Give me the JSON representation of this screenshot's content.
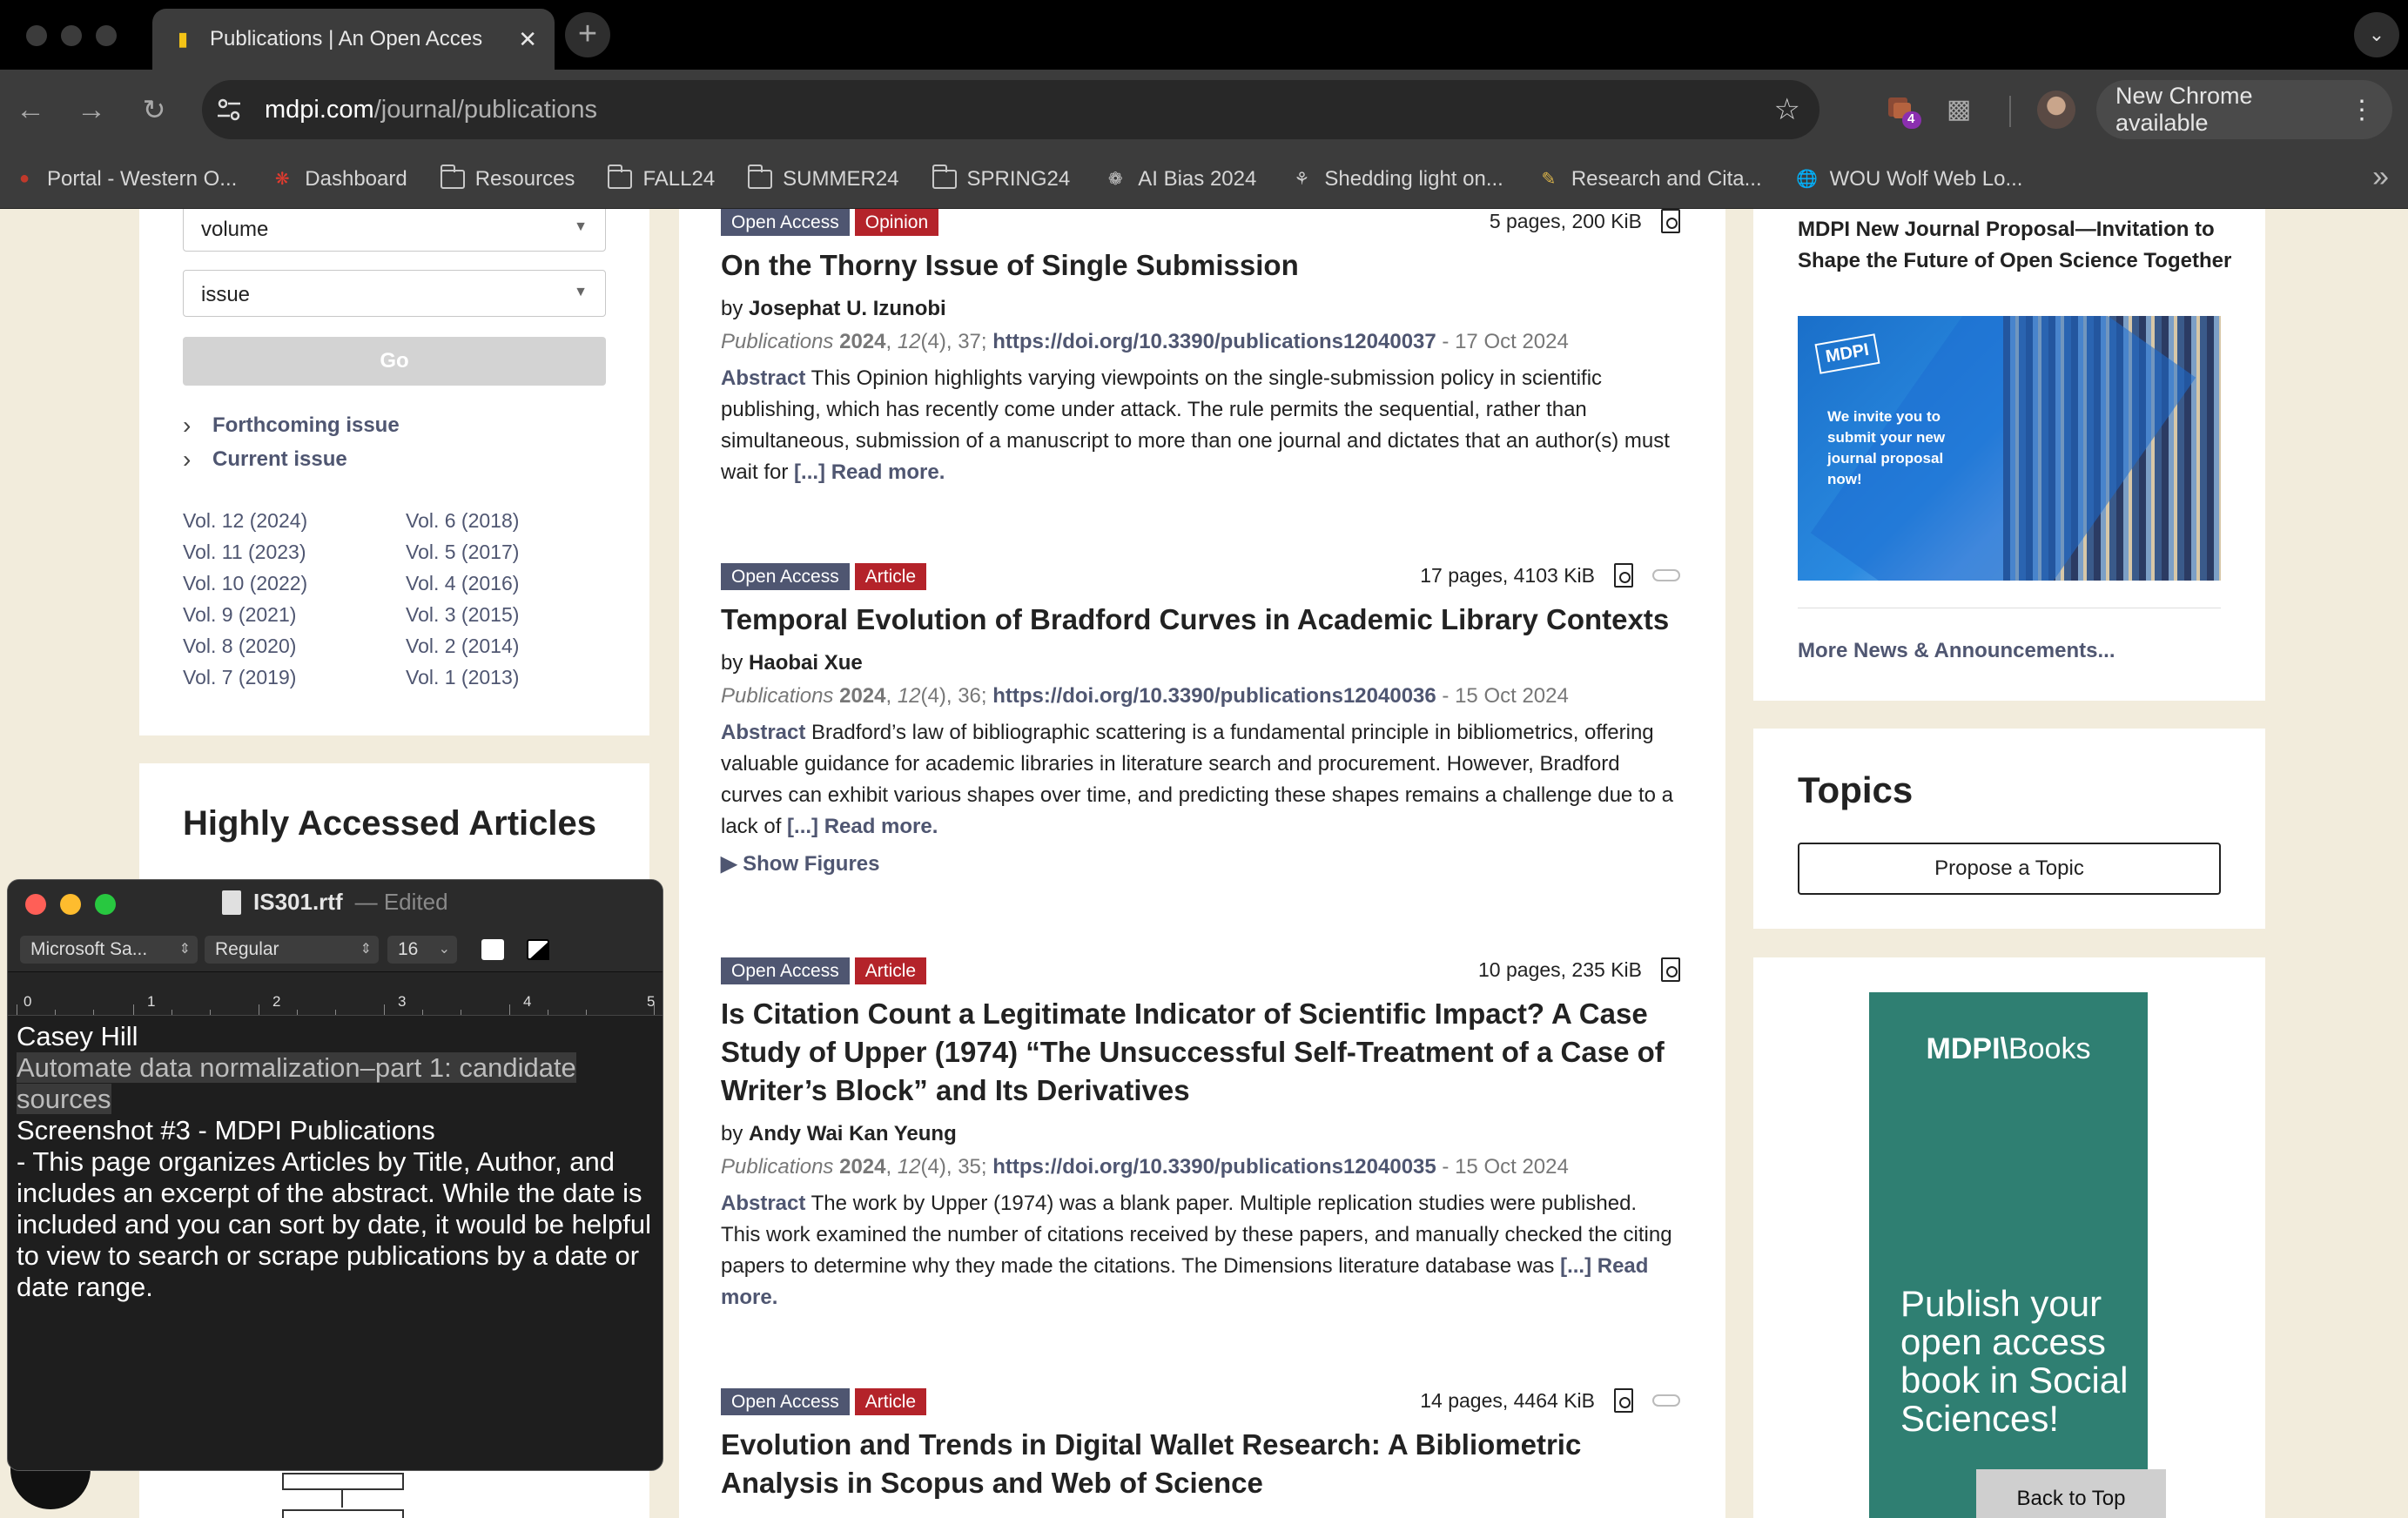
{
  "browser": {
    "tab_title": "Publications | An Open Acces",
    "url_host": "mdpi.com",
    "url_path": "/journal/publications",
    "update_label": "New Chrome available",
    "extension_badge": "4",
    "bookmarks": [
      {
        "label": "Portal - Western O...",
        "icon": "portal-icon"
      },
      {
        "label": "Dashboard",
        "icon": "canvas-icon"
      },
      {
        "label": "Resources",
        "icon": "folder-icon"
      },
      {
        "label": "FALL24",
        "icon": "folder-icon"
      },
      {
        "label": "SUMMER24",
        "icon": "folder-icon"
      },
      {
        "label": "SPRING24",
        "icon": "folder-icon"
      },
      {
        "label": "AI Bias 2024",
        "icon": "ai-icon"
      },
      {
        "label": "Shedding light on...",
        "icon": "network-icon"
      },
      {
        "label": "Research and Cita...",
        "icon": "research-icon"
      },
      {
        "label": "WOU Wolf Web Lo...",
        "icon": "globe-icon"
      }
    ]
  },
  "sidebar": {
    "volume_placeholder": "volume",
    "issue_placeholder": "issue",
    "go_label": "Go",
    "forthcoming_label": "Forthcoming issue",
    "current_label": "Current issue",
    "volumes_left": [
      "Vol. 12 (2024)",
      "Vol. 11 (2023)",
      "Vol. 10 (2022)",
      "Vol. 9 (2021)",
      "Vol. 8 (2020)",
      "Vol. 7 (2019)"
    ],
    "volumes_right": [
      "Vol. 6 (2018)",
      "Vol. 5 (2017)",
      "Vol. 4 (2016)",
      "Vol. 3 (2015)",
      "Vol. 2 (2014)",
      "Vol. 1 (2013)"
    ],
    "highly_accessed_heading": "Highly Accessed Articles"
  },
  "articles": [
    {
      "access": "Open Access",
      "type": "Opinion",
      "meta": "5 pages, 200 KiB",
      "title": "On the Thorny Issue of Single Submission",
      "by_prefix": "by",
      "authors": "Josephat U. Izunobi",
      "journal": "Publications",
      "year": "2024",
      "volume": "12",
      "issue_pages": "(4), 37;",
      "doi": "https://doi.org/10.3390/publications12040037",
      "date": "- 17 Oct 2024",
      "abstract_label": "Abstract",
      "abstract": "This Opinion highlights varying viewpoints on the single-submission policy in scientific publishing, which has recently come under attack. The rule permits the sequential, rather than simultaneous, submission of a manuscript to more than one journal and dictates that an author(s) must wait for",
      "more": "[...] Read more."
    },
    {
      "access": "Open Access",
      "type": "Article",
      "meta": "17 pages, 4103 KiB",
      "title": "Temporal Evolution of Bradford Curves in Academic Library Contexts",
      "by_prefix": "by",
      "authors": "Haobai Xue",
      "journal": "Publications",
      "year": "2024",
      "volume": "12",
      "issue_pages": "(4), 36;",
      "doi": "https://doi.org/10.3390/publications12040036",
      "date": "- 15 Oct 2024",
      "abstract_label": "Abstract",
      "abstract": "Bradford’s law of bibliographic scattering is a fundamental principle in bibliometrics, offering valuable guidance for academic libraries in literature search and procurement. However, Bradford curves can exhibit various shapes over time, and predicting these shapes remains a challenge due to a lack of",
      "more": "[...] Read more.",
      "show_figures": "▶ Show Figures"
    },
    {
      "access": "Open Access",
      "type": "Article",
      "meta": "10 pages, 235 KiB",
      "title": "Is Citation Count a Legitimate Indicator of Scientific Impact? A Case Study of Upper (1974) “The Unsuccessful Self-Treatment of a Case of Writer’s Block” and Its Derivatives",
      "by_prefix": "by",
      "authors": "Andy Wai Kan Yeung",
      "journal": "Publications",
      "year": "2024",
      "volume": "12",
      "issue_pages": "(4), 35;",
      "doi": "https://doi.org/10.3390/publications12040035",
      "date": "- 15 Oct 2024",
      "abstract_label": "Abstract",
      "abstract": "The work by Upper (1974) was a blank paper. Multiple replication studies were published. This work examined the number of citations received by these papers, and manually checked the citing papers to determine why they made the citations. The Dimensions literature database was",
      "more": "[...] Read more."
    },
    {
      "access": "Open Access",
      "type": "Article",
      "meta": "14 pages, 4464 KiB",
      "title": "Evolution and Trends in Digital Wallet Research: A Bibliometric Analysis in Scopus and Web of Science"
    }
  ],
  "right": {
    "news_title": "MDPI New Journal Proposal—Invitation to Shape the Future of Open Science Together",
    "news_image_logo": "MDPI",
    "news_image_text": "We invite you to submit your new journal proposal now!",
    "more_news": "More News & Announcements...",
    "topics_heading": "Topics",
    "propose_label": "Propose a Topic",
    "books_brand": "MDPI",
    "books_brand_suffix": "Books",
    "books_pitch": "Publish your open access book in Social Sciences!",
    "back_to_top": "Back to Top"
  },
  "textedit": {
    "filename": "IS301.rtf",
    "status": "— Edited",
    "font_family": "Microsoft Sa...",
    "font_style": "Regular",
    "font_size": "16",
    "ruler_numbers": [
      "0",
      "1",
      "2",
      "3",
      "4",
      "5"
    ],
    "line1": "Casey Hill",
    "line2": "Automate data normalization–part 1: candidate sources",
    "line3": "Screenshot #3 - MDPI Publications",
    "line4": "- This page organizes Articles by Title, Author, and includes an excerpt of the abstract. While the date is included and you can sort by date, it would be helpful to view to search or scrape publications by a date or date range."
  },
  "colors": {
    "mdpi_link": "#4f5671",
    "badge_type": "#b4232a",
    "page_bg": "#f2ecdc",
    "books_green": "#2f7f72"
  }
}
